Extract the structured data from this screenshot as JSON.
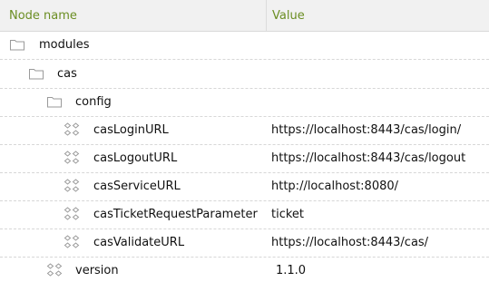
{
  "columns": {
    "name": "Node name",
    "value": "Value"
  },
  "nodes": [
    {
      "label": "modules",
      "icon": "folder-icon",
      "value": ""
    },
    {
      "label": "cas",
      "icon": "folder-icon",
      "value": ""
    },
    {
      "label": "config",
      "icon": "folder-icon",
      "value": ""
    },
    {
      "label": "casLoginURL",
      "icon": "property-node-icon",
      "value": "https://localhost:8443/cas/login/"
    },
    {
      "label": "casLogoutURL",
      "icon": "property-node-icon",
      "value": "https://localhost:8443/cas/logout"
    },
    {
      "label": "casServiceURL",
      "icon": "property-node-icon",
      "value": "http://localhost:8080/"
    },
    {
      "label": "casTicketRequestParameter",
      "icon": "property-node-icon",
      "value": "ticket"
    },
    {
      "label": "casValidateURL",
      "icon": "property-node-icon",
      "value": "https://localhost:8443/cas/"
    },
    {
      "label": "version",
      "icon": "property-node-icon",
      "value": "1.1.0"
    }
  ],
  "colors": {
    "header_text": "#6b8e23",
    "header_bg": "#f1f1f1",
    "icon_stroke": "#9a9a9a"
  }
}
